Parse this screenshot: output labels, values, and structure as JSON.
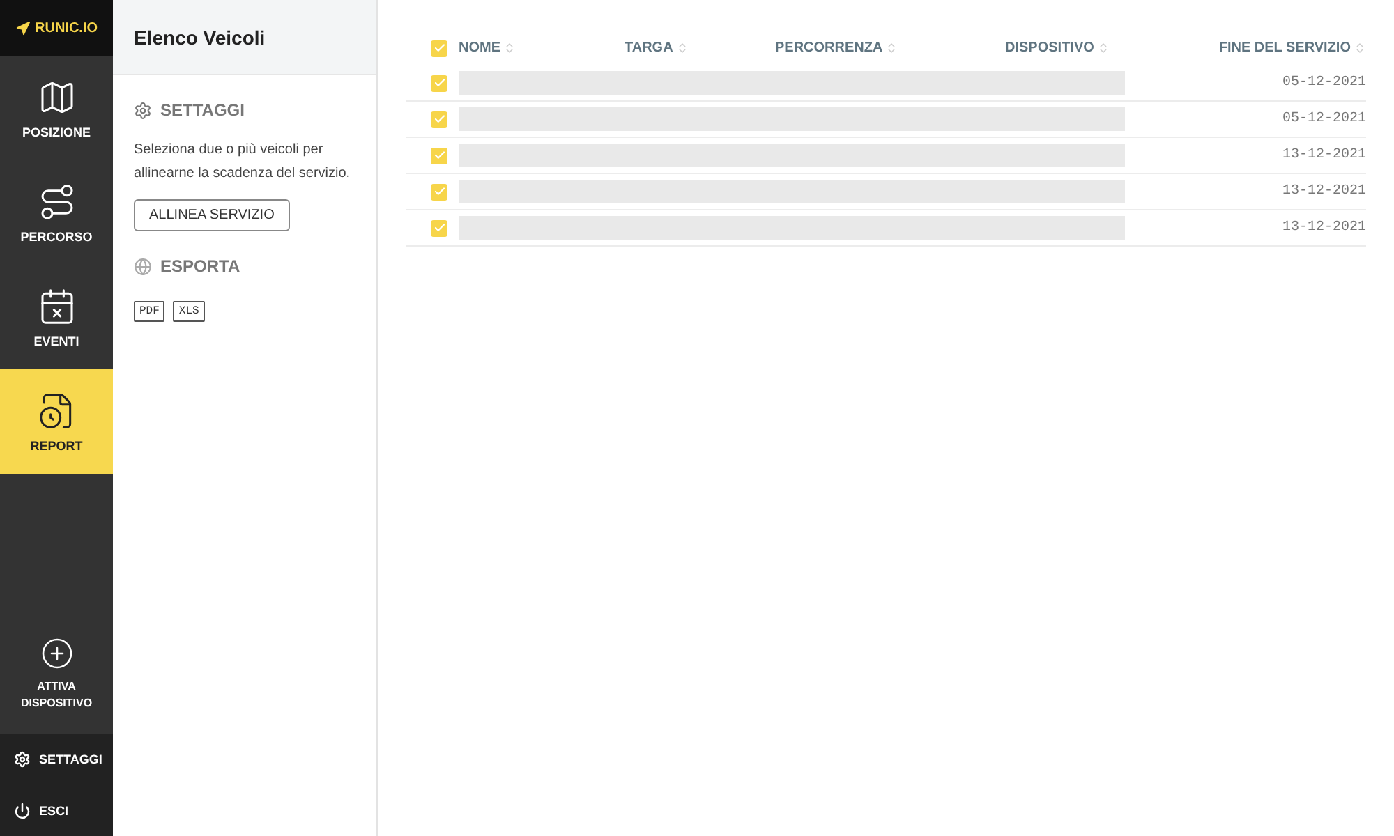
{
  "logo": {
    "text": "RUNIC.IO"
  },
  "nav": [
    {
      "label": "POSIZIONE",
      "selected": false
    },
    {
      "label": "PERCORSO",
      "selected": false
    },
    {
      "label": "EVENTI",
      "selected": false
    },
    {
      "label": "REPORT",
      "selected": true
    }
  ],
  "activate": {
    "label": "ATTIVA DISPOSITIVO"
  },
  "footer": [
    {
      "label": "SETTAGGI"
    },
    {
      "label": "ESCI"
    }
  ],
  "panel": {
    "title": "Elenco Veicoli",
    "settings_heading": "SETTAGGI",
    "description": "Seleziona due o più veicoli per allinearne la scadenza del servizio.",
    "align_button": "ALLINEA SERVIZIO",
    "export_heading": "ESPORTA",
    "export_buttons": [
      "PDF",
      "XLS"
    ]
  },
  "table": {
    "all_checked": true,
    "columns": [
      "NOME",
      "TARGA",
      "PERCORRENZA",
      "DISPOSITIVO",
      "FINE DEL SERVIZIO"
    ],
    "rows": [
      {
        "checked": true,
        "end_date": "05-12-2021"
      },
      {
        "checked": true,
        "end_date": "05-12-2021"
      },
      {
        "checked": true,
        "end_date": "13-12-2021"
      },
      {
        "checked": true,
        "end_date": "13-12-2021"
      },
      {
        "checked": true,
        "end_date": "13-12-2021"
      }
    ]
  }
}
